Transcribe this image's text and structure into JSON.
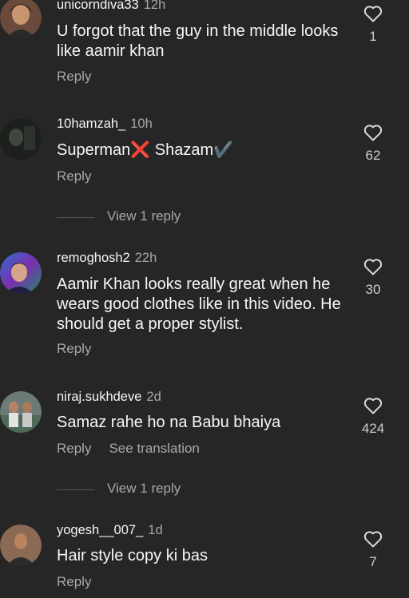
{
  "comments": [
    {
      "username": "unicorndiva33",
      "time": "12h",
      "text": "U forgot that the guy in the middle looks like aamir khan",
      "reply_label": "Reply",
      "likes": "1",
      "colors": {
        "avatar_bg": "#6a4a3a",
        "avatar_face": "#c7956f"
      }
    },
    {
      "username": "10hamzah_",
      "time": "10h",
      "text_parts": [
        "Superman",
        "❌",
        " Shazam",
        "✔️"
      ],
      "reply_label": "Reply",
      "likes": "62",
      "view_replies": "View 1 reply",
      "colors": {
        "avatar_bg": "#1c1f1b",
        "avatar_face": "#3f4740"
      }
    },
    {
      "username": "remoghosh2",
      "time": "22h",
      "text": "Aamir Khan looks really great when he wears good clothes like in this video. He should get a proper stylist.",
      "reply_label": "Reply",
      "likes": "30",
      "colors": {
        "avatar_bg": "#4b2d80",
        "avatar_face": "#d6a48a"
      }
    },
    {
      "username": "niraj.sukhdeve",
      "time": "2d",
      "text": "Samaz rahe ho na Babu bhaiya",
      "reply_label": "Reply",
      "translation_label": "See translation",
      "likes": "424",
      "view_replies": "View 1 reply",
      "colors": {
        "avatar_bg": "#6d7b76",
        "avatar_face": "#e3e3e3"
      }
    },
    {
      "username": "yogesh__007_",
      "time": "1d",
      "text": "Hair style copy ki bas",
      "reply_label": "Reply",
      "likes": "7",
      "colors": {
        "avatar_bg": "#8a6a55",
        "avatar_face": "#2b2b2b"
      }
    }
  ]
}
